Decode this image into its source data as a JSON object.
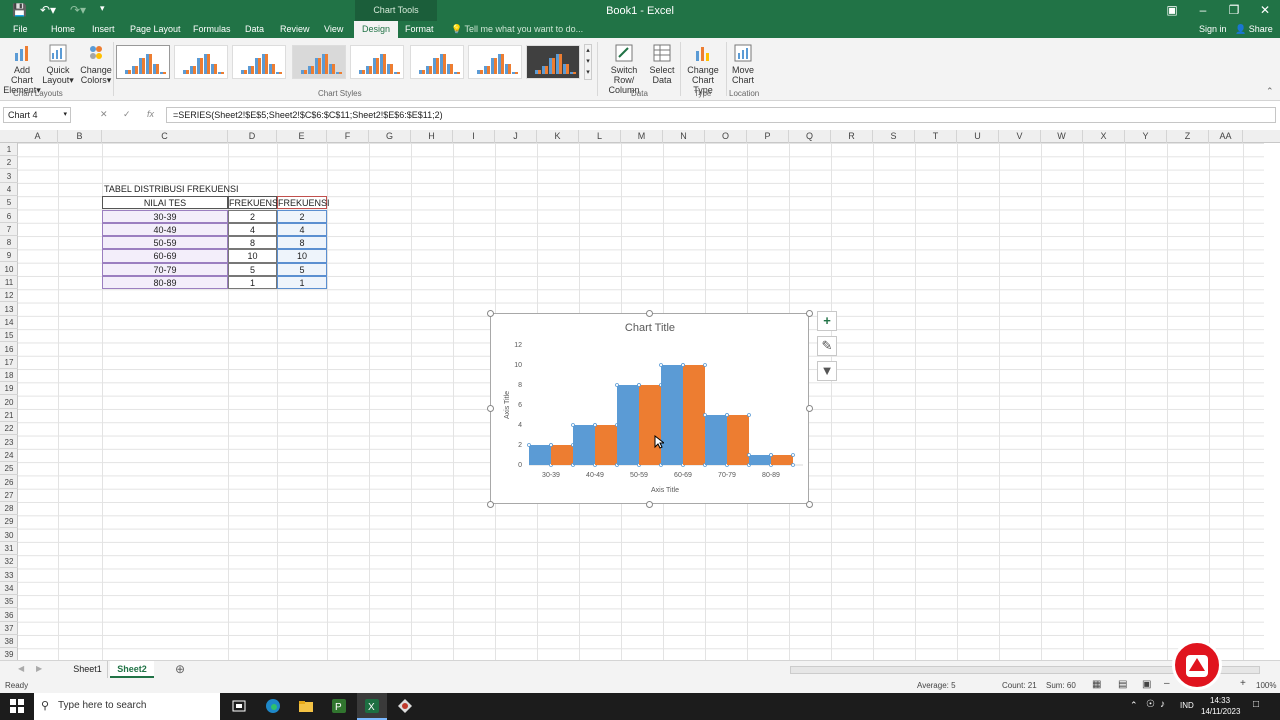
{
  "window": {
    "title": "Book1 - Excel",
    "context_tab": "Chart Tools",
    "signin": "Sign in",
    "share": "Share"
  },
  "tabs": [
    "File",
    "Home",
    "Insert",
    "Page Layout",
    "Formulas",
    "Data",
    "Review",
    "View",
    "Design",
    "Format"
  ],
  "active_tab": "Design",
  "tell_me": "Tell me what you want to do...",
  "ribbon": {
    "add_chart_element": [
      "Add Chart",
      "Element"
    ],
    "quick_layout": [
      "Quick",
      "Layout"
    ],
    "change_colors": [
      "Change",
      "Colors"
    ],
    "switch_row_column": [
      "Switch Row/",
      "Column"
    ],
    "select_data": [
      "Select",
      "Data"
    ],
    "change_chart_type": [
      "Change",
      "Chart Type"
    ],
    "move_chart": [
      "Move",
      "Chart"
    ],
    "groups": {
      "chart_layouts": "Chart Layouts",
      "chart_styles": "Chart Styles",
      "data": "Data",
      "type": "Type",
      "location": "Location"
    }
  },
  "formula_bar": {
    "name_box": "Chart 4",
    "fx": "fx",
    "formula": "=SERIES(Sheet2!$E$5;Sheet2!$C$6:$C$11;Sheet2!$E$6:$E$11;2)"
  },
  "columns": [
    "A",
    "B",
    "C",
    "D",
    "E",
    "F",
    "G",
    "H",
    "I",
    "J",
    "K",
    "L",
    "M",
    "N",
    "O",
    "P",
    "Q",
    "R",
    "S",
    "T",
    "U",
    "V",
    "W",
    "X",
    "Y",
    "Z",
    "AA"
  ],
  "rows": [
    "1",
    "2",
    "3",
    "4",
    "5",
    "6",
    "7",
    "8",
    "9",
    "10",
    "11",
    "12",
    "13",
    "14",
    "15",
    "16",
    "17",
    "18",
    "19",
    "20",
    "21",
    "22",
    "23",
    "24",
    "25",
    "26",
    "27",
    "28",
    "29",
    "30",
    "31",
    "32",
    "33",
    "34",
    "35",
    "36",
    "37",
    "38",
    "39"
  ],
  "table": {
    "title": "TABEL DISTRIBUSI FREKUENSI",
    "headers": [
      "NILAI TES",
      "FREKUENSI",
      "FREKUENSI"
    ],
    "rows": [
      [
        "30-39",
        "2",
        "2"
      ],
      [
        "40-49",
        "4",
        "4"
      ],
      [
        "50-59",
        "8",
        "8"
      ],
      [
        "60-69",
        "10",
        "10"
      ],
      [
        "70-79",
        "5",
        "5"
      ],
      [
        "80-89",
        "1",
        "1"
      ]
    ]
  },
  "chart_data": {
    "type": "bar",
    "title": "Chart Title",
    "xlabel": "Axis Title",
    "ylabel": "Axis Title",
    "categories": [
      "30-39",
      "40-49",
      "50-59",
      "60-69",
      "70-79",
      "80-89"
    ],
    "series": [
      {
        "values": [
          2,
          4,
          8,
          10,
          5,
          1
        ],
        "color": "#5b9bd5"
      },
      {
        "values": [
          2,
          4,
          8,
          10,
          5,
          1
        ],
        "color": "#ed7d31"
      }
    ],
    "ylim": [
      0,
      12
    ],
    "yticks": [
      "0",
      "2",
      "4",
      "6",
      "8",
      "10",
      "12"
    ],
    "gap": "none",
    "grid": false
  },
  "sheets": [
    "Sheet1",
    "Sheet2"
  ],
  "active_sheet": "Sheet2",
  "status": {
    "ready": "Ready",
    "average": "Average: 5",
    "count": "Count: 21",
    "sum": "Sum: 60",
    "zoom": "100%"
  },
  "taskbar": {
    "search": "Type here to search",
    "time": "14:33",
    "date": "14/11/2023",
    "lang": "IND"
  }
}
